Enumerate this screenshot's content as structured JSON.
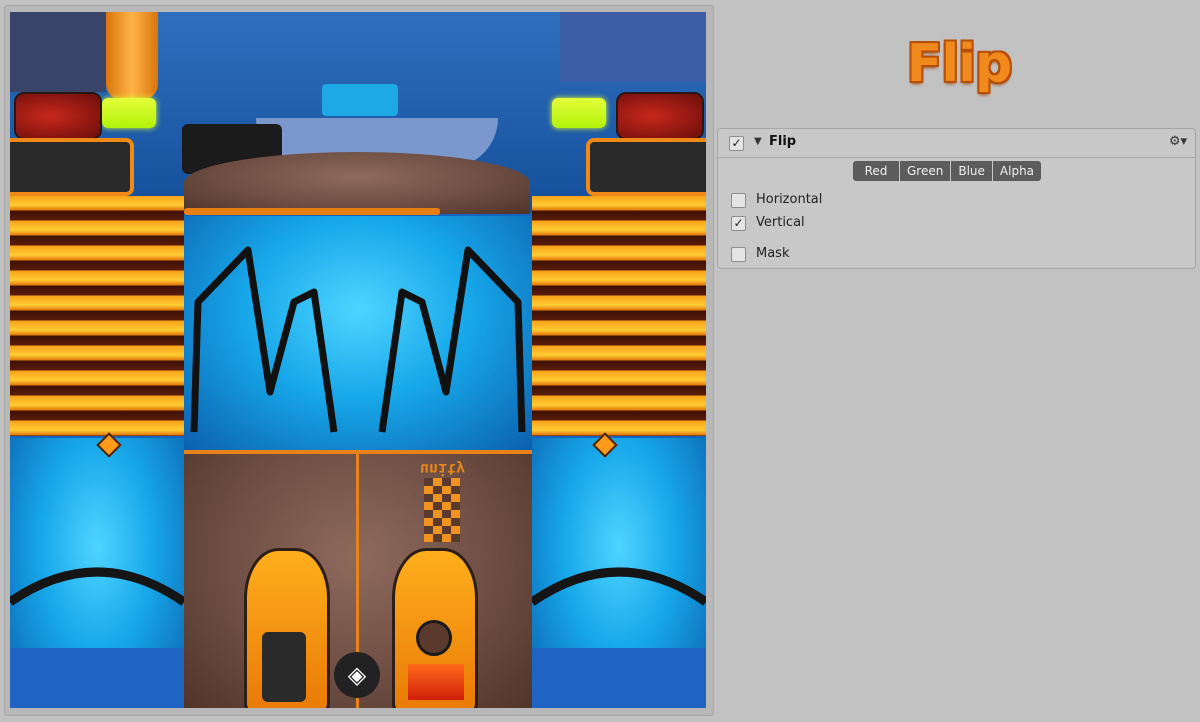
{
  "app": {
    "title": "Flip"
  },
  "preview": {
    "mirrored_logo_text": "unity"
  },
  "inspector": {
    "component_title": "Flip",
    "component_enabled": true,
    "channels": [
      "Red",
      "Green",
      "Blue",
      "Alpha"
    ],
    "options": [
      {
        "label": "Horizontal",
        "checked": false
      },
      {
        "label": "Vertical",
        "checked": true
      },
      {
        "label": "Mask",
        "checked": false
      }
    ]
  },
  "icons": {
    "foldout": "triangle-down-icon",
    "settings": "gear-icon",
    "check": "checkmark-icon"
  },
  "colors": {
    "background": "#c2c2c2",
    "title_orange": "#f08a1c",
    "channel_button": "#5c5c5c"
  }
}
